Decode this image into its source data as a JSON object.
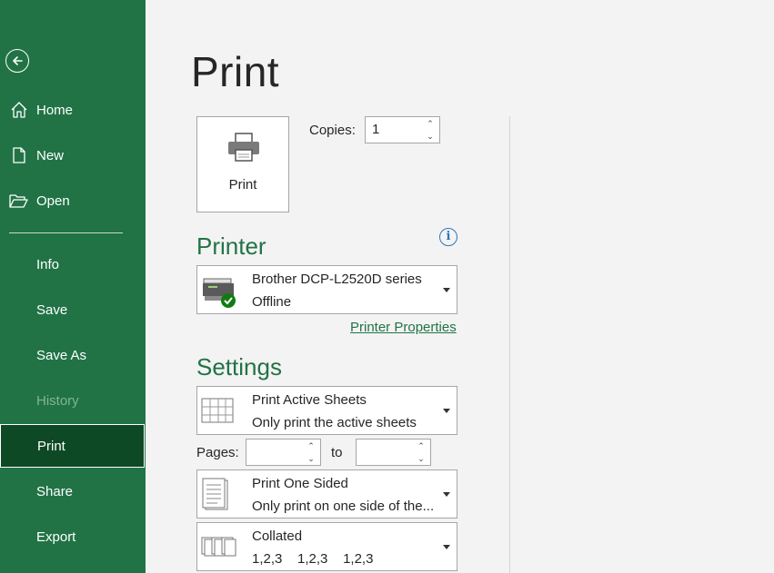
{
  "sidebar": {
    "back_icon": "back-arrow-icon",
    "items": [
      {
        "label": "Home",
        "icon": "home-icon"
      },
      {
        "label": "New",
        "icon": "new-document-icon"
      },
      {
        "label": "Open",
        "icon": "open-folder-icon"
      },
      {
        "label": "Info"
      },
      {
        "label": "Save"
      },
      {
        "label": "Save As"
      },
      {
        "label": "History",
        "disabled": true
      },
      {
        "label": "Print",
        "active": true
      },
      {
        "label": "Share"
      },
      {
        "label": "Export"
      }
    ],
    "colors": {
      "background": "#217346",
      "active": "#0e4925"
    }
  },
  "main": {
    "title": "Print",
    "print_button": {
      "label": "Print",
      "icon": "printer-icon"
    },
    "copies": {
      "label": "Copies:",
      "value": "1"
    },
    "printer_section": {
      "title": "Printer",
      "info_icon": "info-icon",
      "selected_name": "Brother DCP-L2520D series",
      "selected_status": "Offline",
      "properties_link": "Printer Properties"
    },
    "settings_section": {
      "title": "Settings",
      "what_to_print": {
        "title": "Print Active Sheets",
        "subtitle": "Only print the active sheets"
      },
      "pages": {
        "label": "Pages:",
        "from": "",
        "to_label": "to",
        "to": ""
      },
      "sides": {
        "title": "Print One Sided",
        "subtitle": "Only print on one side of the..."
      },
      "collation": {
        "title": "Collated",
        "subtitle": "1,2,3    1,2,3    1,2,3"
      }
    },
    "accent_color": "#217346"
  }
}
